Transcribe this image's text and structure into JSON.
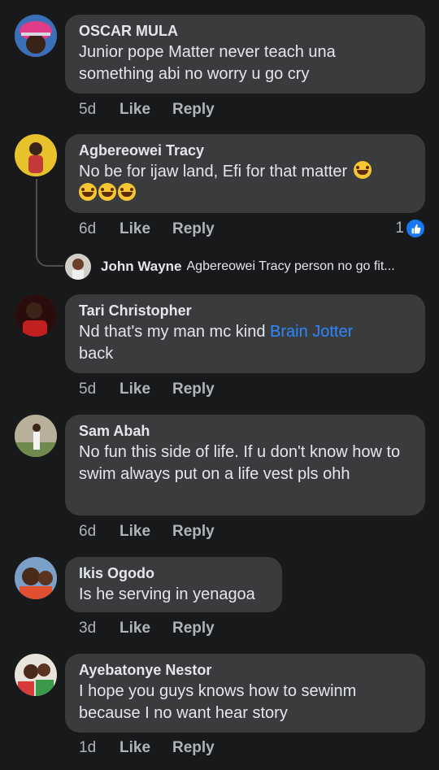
{
  "comments": [
    {
      "name": "OSCAR MULA",
      "text": "Junior pope Matter never teach una something abi no worry u go cry",
      "time": "5d",
      "like": "Like",
      "reply": "Reply"
    },
    {
      "name": "Agbereowei Tracy",
      "text": "No be for ijaw land, Efi for that matter",
      "time": "6d",
      "like": "Like",
      "reply": "Reply",
      "reaction_count": "1",
      "emojis": [
        "face-with-tears-of-joy",
        "face-with-tears-of-joy",
        "face-with-tears-of-joy",
        "face-with-tears-of-joy"
      ]
    },
    {
      "name": "Tari Christopher",
      "text_before": "Nd that's my man mc kind ",
      "mention": "Brain Jotter",
      "text_after": "back",
      "time": "5d",
      "like": "Like",
      "reply": "Reply"
    },
    {
      "name": "Sam Abah",
      "text": "No fun this side of life. If u don't know how to swim always put on a life vest pls ohh",
      "time": "6d",
      "like": "Like",
      "reply": "Reply"
    },
    {
      "name": "Ikis Ogodo",
      "text": "Is he serving in yenagoa",
      "time": "3d",
      "like": "Like",
      "reply": "Reply"
    },
    {
      "name": "Ayebatonye Nestor",
      "text": "I hope you guys knows how to sewinm because I no want hear story",
      "time": "1d",
      "like": "Like",
      "reply": "Reply"
    }
  ],
  "reply_preview": {
    "name": "John Wayne",
    "text": "Agbereowei Tracy person no go fit..."
  },
  "colors": {
    "background": "#18191a",
    "bubble": "#3a3b3c",
    "meta_text": "#b0b3b8",
    "mention": "#2d88ff",
    "like_badge": "#1877f2"
  }
}
